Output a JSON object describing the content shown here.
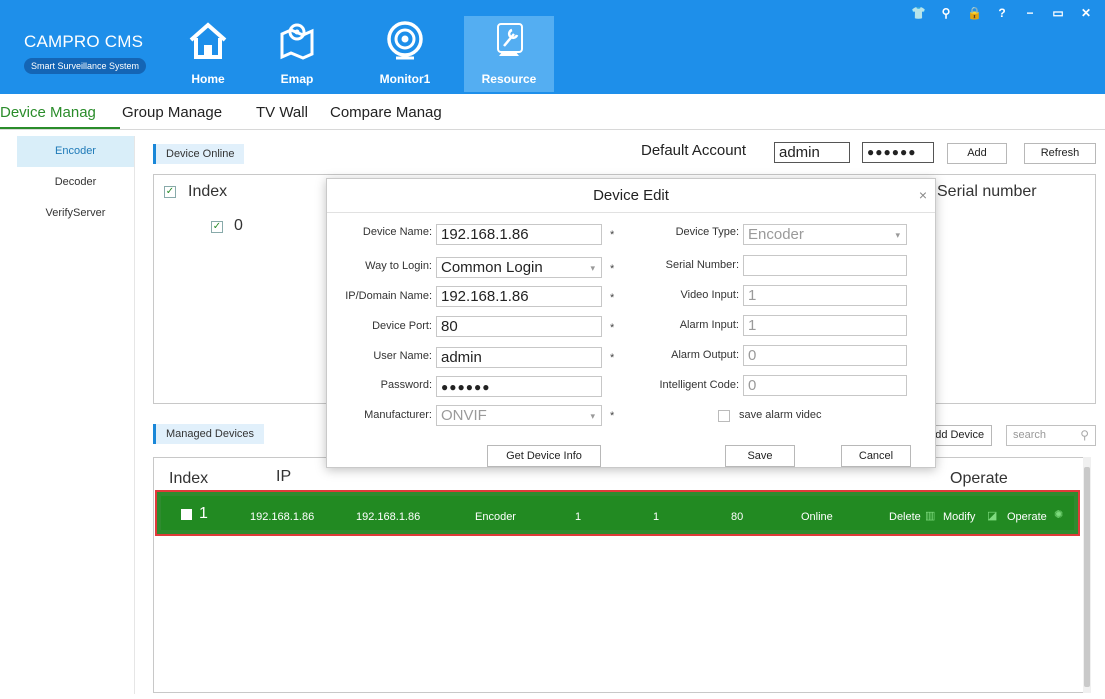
{
  "app": {
    "title": "CAMPRO CMS",
    "subtitle": "Smart Surveillance System"
  },
  "nav": [
    {
      "label": "Home",
      "icon": "home-icon"
    },
    {
      "label": "Emap",
      "icon": "map-icon"
    },
    {
      "label": "Monitor1",
      "icon": "camera-icon"
    },
    {
      "label": "Resource",
      "icon": "wrench-icon"
    }
  ],
  "tabs": [
    "Device Manag",
    "Group Manage",
    "TV Wall",
    "Compare Manag"
  ],
  "sidebar": [
    "Encoder",
    "Decoder",
    "VerifyServer"
  ],
  "online": {
    "section_label": "Device Online",
    "default_account_label": "Default Account",
    "default_account_value": "admin",
    "default_password": "●●●●●●",
    "add_label": "Add",
    "refresh_label": "Refresh",
    "col_index": "Index",
    "col_serial": "Serial number",
    "row_index": "0"
  },
  "managed": {
    "section_label": "Managed Devices",
    "add_device_label": "Add Device",
    "search_placeholder": "search",
    "col_index": "Index",
    "col_ip": "IP",
    "col_operate": "Operate",
    "row": {
      "index": "1",
      "name": "192.168.1.86",
      "ip": "192.168.1.86",
      "type": "Encoder",
      "video": "1",
      "alarm": "1",
      "port": "80",
      "status": "Online",
      "delete": "Delete",
      "modify": "Modify",
      "operate": "Operate"
    }
  },
  "modal": {
    "title": "Device Edit",
    "fields_left": {
      "device_name_label": "Device Name:",
      "device_name": "192.168.1.86",
      "login_label": "Way to Login:",
      "login": "Common Login",
      "ip_label": "IP/Domain Name:",
      "ip": "192.168.1.86",
      "port_label": "Device Port:",
      "port": "80",
      "user_label": "User Name:",
      "user": "admin",
      "password_label": "Password:",
      "password": "●●●●●●",
      "manufacturer_label": "Manufacturer:",
      "manufacturer": "ONVIF"
    },
    "fields_right": {
      "type_label": "Device Type:",
      "type": "Encoder",
      "serial_label": "Serial Number:",
      "serial": "",
      "video_label": "Video Input:",
      "video": "1",
      "alarm_in_label": "Alarm Input:",
      "alarm_in": "1",
      "alarm_out_label": "Alarm Output:",
      "alarm_out": "0",
      "intelligent_label": "Intelligent Code:",
      "intelligent": "0",
      "save_alarm_label": "save alarm videc"
    },
    "required_mark": "*",
    "get_info_label": "Get Device Info",
    "save_label": "Save",
    "cancel_label": "Cancel",
    "close_glyph": "×"
  },
  "colors": {
    "header": "#1e8fea",
    "row_green": "#228a22",
    "row_border": "#e03a3a"
  }
}
